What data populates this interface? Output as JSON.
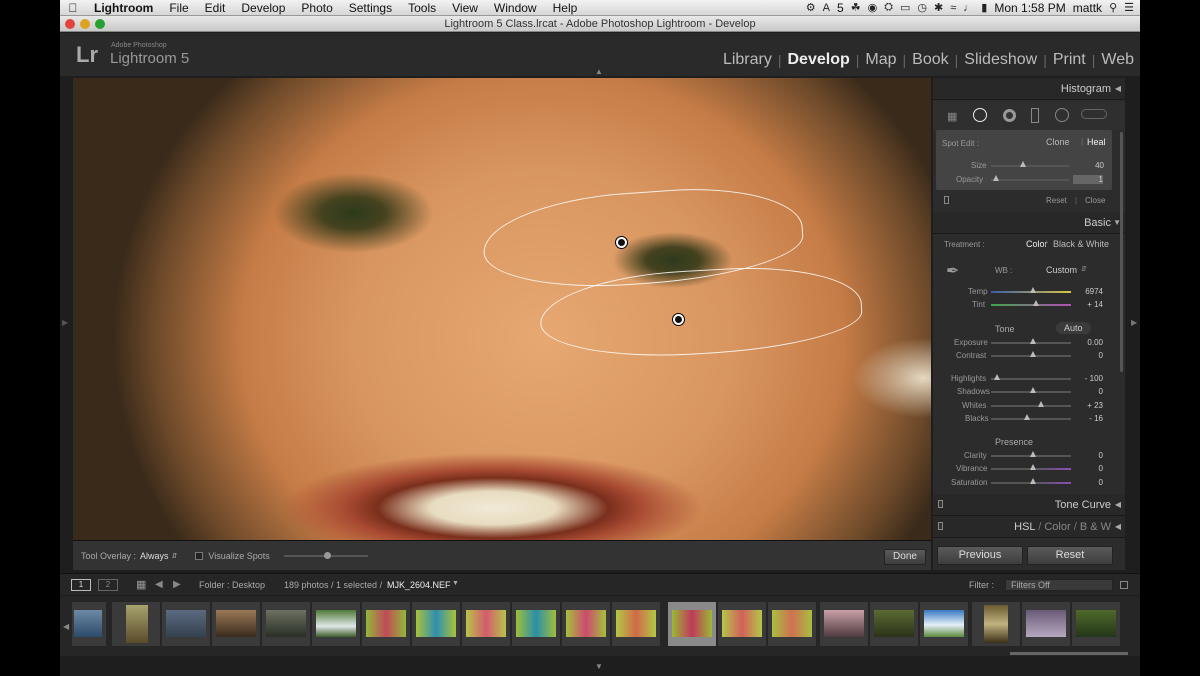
{
  "menubar": {
    "app": "Lightroom",
    "items": [
      "File",
      "Edit",
      "Develop",
      "Photo",
      "Settings",
      "Tools",
      "View",
      "Window",
      "Help"
    ],
    "badge": "5",
    "clock": "Mon 1:58 PM",
    "user": "mattk"
  },
  "window": {
    "title": "Lightroom 5 Class.lrcat - Adobe Photoshop Lightroom - Develop"
  },
  "header": {
    "logo": "Lr",
    "brand_small": "Adobe Photoshop",
    "brand": "Lightroom 5",
    "modules": [
      "Library",
      "Develop",
      "Map",
      "Book",
      "Slideshow",
      "Print",
      "Web"
    ],
    "active_module": "Develop"
  },
  "toolbar": {
    "tool_overlay_label": "Tool Overlay :",
    "tool_overlay_value": "Always",
    "visualize_spots": "Visualize Spots",
    "visualize_spots_level": 0.5,
    "done": "Done"
  },
  "panels": {
    "histogram": "Histogram",
    "spot_edit": {
      "label": "Spot Edit :",
      "clone": "Clone",
      "heal": "Heal",
      "size_label": "Size",
      "size_value": "40",
      "opacity_label": "Opacity",
      "opacity_value": "1",
      "reset": "Reset",
      "close": "Close"
    },
    "basic": {
      "title": "Basic",
      "treatment_label": "Treatment :",
      "color": "Color",
      "bw": "Black & White",
      "wb_label": "WB :",
      "wb_value": "Custom",
      "temp_label": "Temp",
      "temp_value": "6974",
      "tint_label": "Tint",
      "tint_value": "+ 14",
      "tone": "Tone",
      "auto": "Auto",
      "exposure_label": "Exposure",
      "exposure_value": "0.00",
      "contrast_label": "Contrast",
      "contrast_value": "0",
      "highlights_label": "Highlights",
      "highlights_value": "- 100",
      "shadows_label": "Shadows",
      "shadows_value": "0",
      "whites_label": "Whites",
      "whites_value": "+ 23",
      "blacks_label": "Blacks",
      "blacks_value": "- 16",
      "presence": "Presence",
      "clarity_label": "Clarity",
      "clarity_value": "0",
      "vibrance_label": "Vibrance",
      "vibrance_value": "0",
      "saturation_label": "Saturation",
      "saturation_value": "0"
    },
    "tone_curve": "Tone Curve",
    "hsl": "HSL",
    "hsl_color": "Color",
    "hsl_bw": "B & W",
    "previous": "Previous",
    "reset": "Reset"
  },
  "filmstrip_bar": {
    "page1": "1",
    "page2": "2",
    "folder": "Folder : Desktop",
    "count": "189 photos / 1 selected /",
    "filename": "MJK_2604.NEF",
    "filter_label": "Filter :",
    "filter_value": "Filters Off"
  },
  "colors": {
    "accent": "#d9d9d9",
    "panel_bg": "#2c2c2c",
    "active_thumb": "#8a8a8a"
  }
}
